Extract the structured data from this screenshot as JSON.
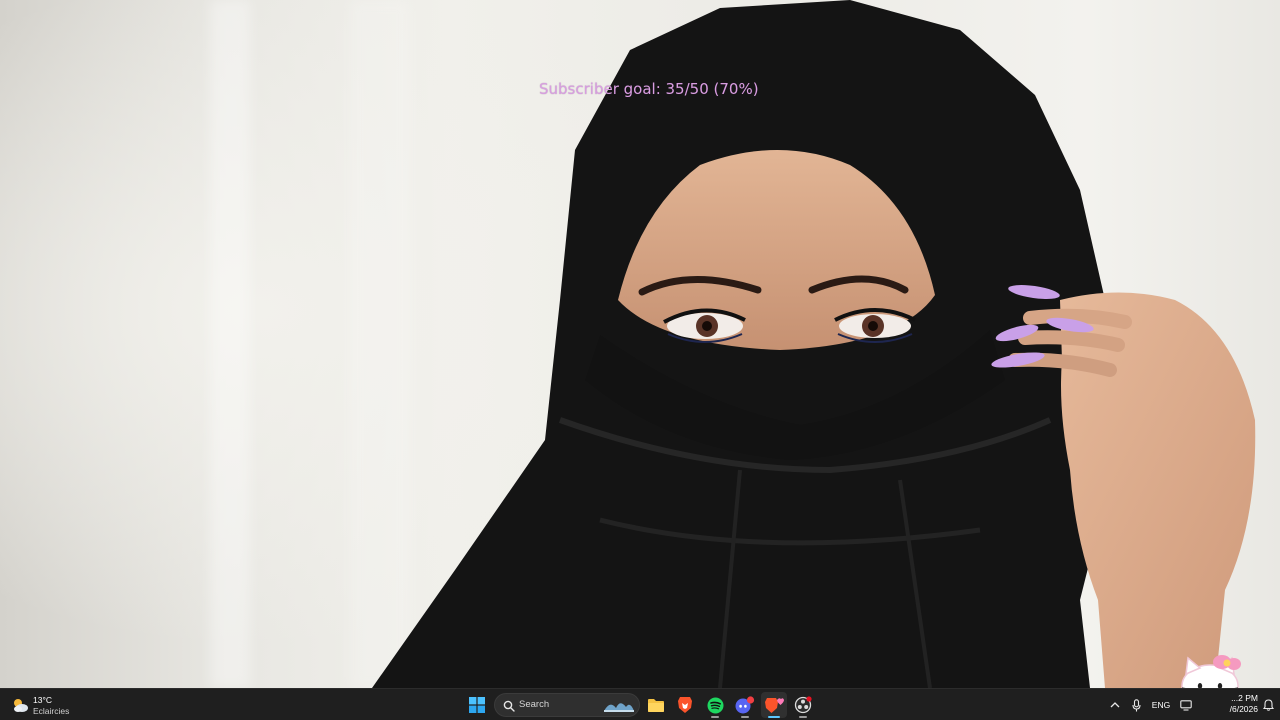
{
  "overlay": {
    "goal_prefix": "Subscriber goal: ",
    "goal_count": "35/50",
    "goal_percent": "(70%)",
    "goal_progress": 0.7,
    "color": "#d89ee0"
  },
  "wallpaper": {
    "subject_icon": "woman-in-black-niqab",
    "nail_color": "#c9a0e8"
  },
  "sticker": {
    "icon": "hello-kitty-sticker-icon"
  },
  "taskbar": {
    "background": "#1f1f1f",
    "weather": {
      "temperature": "13°C",
      "condition": "Eclaircies",
      "icon": "partly-cloudy-icon"
    },
    "search": {
      "label": "Search",
      "icon": "search-icon"
    },
    "apps": [
      {
        "name": "start-button",
        "icon": "windows-logo-icon",
        "running": false
      },
      {
        "name": "file-explorer",
        "icon": "folder-icon",
        "running": false
      },
      {
        "name": "brave-browser",
        "icon": "brave-lion-icon",
        "running": false
      },
      {
        "name": "spotify",
        "icon": "spotify-icon",
        "running": true
      },
      {
        "name": "discord",
        "icon": "discord-icon",
        "running": true
      },
      {
        "name": "brave-beta",
        "icon": "brave-heart-icon",
        "running": true,
        "focused": true
      },
      {
        "name": "obs-studio",
        "icon": "obs-icon",
        "running": true
      }
    ],
    "tray": {
      "overflow_icon": "chevron-up-icon",
      "mic_icon": "microphone-icon",
      "language": "ENG",
      "clock_time": "...2 PM",
      "clock_date": "/6/2026",
      "notification_icon": "notification-bell-icon"
    }
  }
}
